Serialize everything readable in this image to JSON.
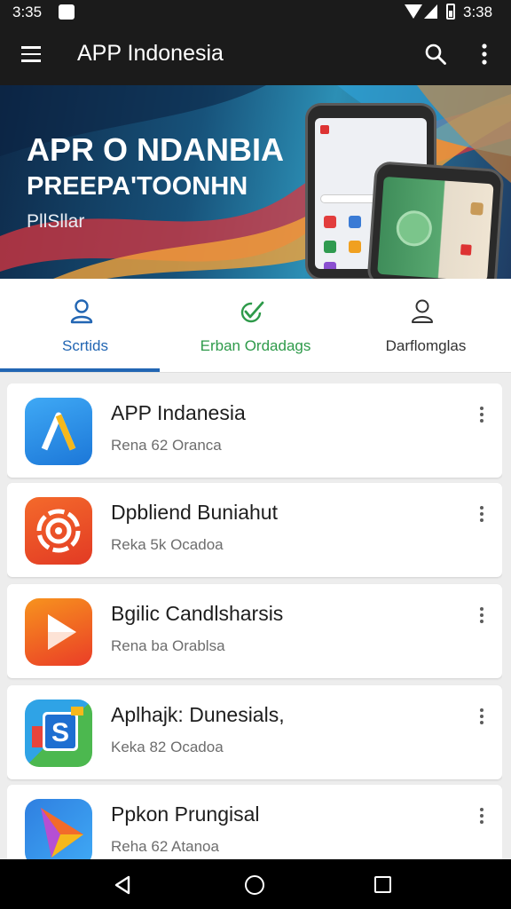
{
  "status": {
    "time_left": "3:35",
    "time_right": "3:38"
  },
  "app_bar": {
    "title": "APP Indonesia"
  },
  "banner": {
    "line1": "APR O NDANBIA",
    "line2": "PREEPA'TOONHN",
    "line3": "PllSllar"
  },
  "tabs": [
    {
      "label": "Scrtids",
      "icon": "person-icon",
      "color": "#2266b3",
      "active": true
    },
    {
      "label": "Erban Ordadags",
      "icon": "checkmark-icon",
      "color": "#2e9a4a",
      "active": false
    },
    {
      "label": "Darflomglas",
      "icon": "person-outline-icon",
      "color": "#333333",
      "active": false
    }
  ],
  "apps": [
    {
      "name": "APP Indanesia",
      "subtitle": "Rena 62 Oranca",
      "icon": "a-logo-icon"
    },
    {
      "name": "Dpbliend Buniahut",
      "subtitle": "Reka 5k Ocadoa",
      "icon": "target-logo-icon"
    },
    {
      "name": "Bgilic Candlsharsis",
      "subtitle": "Rena ba Orablsa",
      "icon": "play-logo-icon"
    },
    {
      "name": "Aplhajk: Dunesials,",
      "subtitle": "Keka 82 Ocadoa",
      "icon": "s-logo-icon"
    },
    {
      "name": "Ppkon Prungisal",
      "subtitle": "Reha 62 Atanoa",
      "icon": "kite-logo-icon"
    }
  ],
  "colors": {
    "bar": "#1b1b1b",
    "accent": "#2266b3",
    "green": "#2e9a4a"
  }
}
